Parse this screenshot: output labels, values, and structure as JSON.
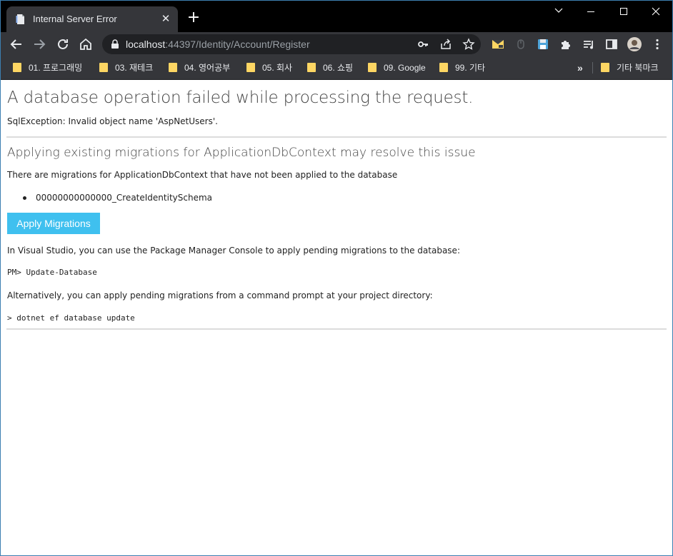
{
  "browser": {
    "tab_title": "Internal Server Error",
    "url_host": "localhost",
    "url_rest": ":44397/Identity/Account/Register",
    "bookmarks": [
      "01. 프로그래밍",
      "03. 재테크",
      "04. 영어공부",
      "05. 회사",
      "06. 쇼핑",
      "09. Google",
      "99. 기타"
    ],
    "overflow": "»",
    "other_bookmarks": "기타 북마크"
  },
  "page": {
    "heading": "A database operation failed while processing the request.",
    "exception": "SqlException: Invalid object name 'AspNetUsers'.",
    "subheading": "Applying existing migrations for ApplicationDbContext may resolve this issue",
    "migrations_text": "There are migrations for ApplicationDbContext that have not been applied to the database",
    "migrations": [
      "00000000000000_CreateIdentitySchema"
    ],
    "apply_button": "Apply Migrations",
    "vs_text": "In Visual Studio, you can use the Package Manager Console to apply pending migrations to the database:",
    "pm_command": "PM> Update-Database",
    "alt_text": "Alternatively, you can apply pending migrations from a command prompt at your project directory:",
    "cli_command": "> dotnet ef database update"
  },
  "colors": {
    "button": "#3fc0ef",
    "tab_bar": "#000000",
    "toolbar": "#35363a"
  }
}
